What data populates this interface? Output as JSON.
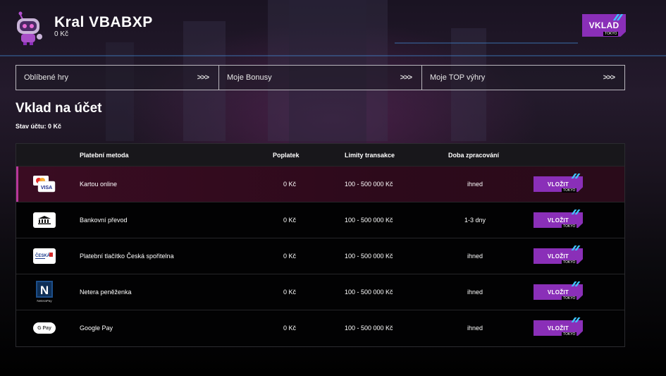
{
  "header": {
    "username": "Kral VBABXP",
    "balance": "0 Kč",
    "deposit_button": "VKLAD",
    "deposit_tag": "TOKYO"
  },
  "nav": {
    "items": [
      {
        "label": "Oblíbené hry",
        "arrows": ">>>"
      },
      {
        "label": "Moje Bonusy",
        "arrows": ">>>"
      },
      {
        "label": "Moje TOP výhry",
        "arrows": ">>>"
      }
    ]
  },
  "page": {
    "title": "Vklad na účet",
    "account_state": "Stav účtu: 0 Kč"
  },
  "table": {
    "headers": {
      "method": "Platební metoda",
      "fee": "Poplatek",
      "limits": "Limity transakce",
      "time": "Doba zpracování"
    },
    "button_label": "VLOŽIT",
    "button_tag": "TOKYO",
    "rows": [
      {
        "method": "Kartou online",
        "fee": "0 Kč",
        "limits": "100 - 500 000 Kč",
        "time": "ihned",
        "logo": "card-visa-mastercard",
        "logo_text": "VISA"
      },
      {
        "method": "Bankovní převod",
        "fee": "0 Kč",
        "limits": "100 - 500 000 Kč",
        "time": "1-3 dny",
        "logo": "bank",
        "logo_text": ""
      },
      {
        "method": "Platební tlačítko Česká spořitelna",
        "fee": "0 Kč",
        "limits": "100 - 500 000 Kč",
        "time": "ihned",
        "logo": "ceska-sporitelna",
        "logo_text": "ČESKÁ"
      },
      {
        "method": "Netera peněženka",
        "fee": "0 Kč",
        "limits": "100 - 500 000 Kč",
        "time": "ihned",
        "logo": "netera-pay",
        "logo_text": "NeteraPay"
      },
      {
        "method": "Google Pay",
        "fee": "0 Kč",
        "limits": "100 - 500 000 Kč",
        "time": "ihned",
        "logo": "google-pay",
        "logo_text": "G Pay"
      }
    ]
  },
  "colors": {
    "accent": "#8a2fb8",
    "slash": "#3fc3ff",
    "active_row": "#3a0c22",
    "active_border": "#b7379a"
  }
}
